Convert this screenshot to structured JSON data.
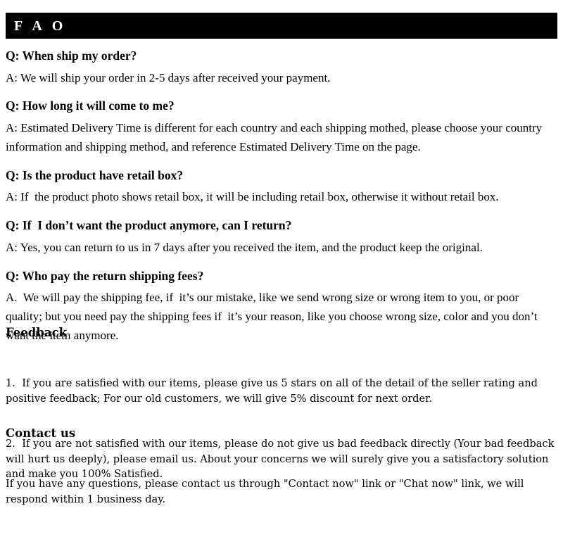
{
  "header": {
    "title": "F A O"
  },
  "faq": {
    "items": [
      {
        "question": "Q: When ship my order?",
        "answer": "A: We will ship your order in 2-5 days after received your payment."
      },
      {
        "question": "Q: How long it will come to me?",
        "answer": "A: Estimated Delivery Time is different for each country and each shipping mothed, please choose your country information and shipping method, and reference Estimated Delivery Time on the page."
      },
      {
        "question": "Q: Is the product have retail box?",
        "answer": "A: If  the product photo shows retail box, it will be including retail box, otherwise it without retail box."
      },
      {
        "question": "Q: If  I don’t want the product anymore, can I return?",
        "answer": "A: Yes, you can return to us in 7 days after you received the item, and the product keep the original."
      },
      {
        "question": "Q: Who pay the return shipping fees?",
        "answer": "A.  We will pay the shipping fee, if  it’s our mistake, like we send wrong size or wrong item to you, or poor quality; but you need pay the shipping fees if  it’s your reason, like you choose wrong size, color and you don’t want the item anymore."
      }
    ]
  },
  "feedback": {
    "heading": "Feedback",
    "line1": "1.  If you are satisfied with our items, please give us 5 stars on all of the detail of the seller rating and positive feedback; For our old customers, we will give 5% discount for next order.",
    "line2": "2.  If you are not satisfied with our items, please do not give us bad feedback directly (Your bad feedback will hurt us deeply), please email us. About your concerns we will surely give you a satisfactory solution and make you 100% Satisfied."
  },
  "contact": {
    "heading": "Contact us",
    "body": "If you have any questions, please contact us through \"Contact now\" link or \"Chat now\" link, we will respond within 1 business day."
  },
  "colors": {
    "header_background": "#000000",
    "header_text": "#ffffff",
    "page_background": "#ffffff",
    "body_text": "#000000"
  }
}
